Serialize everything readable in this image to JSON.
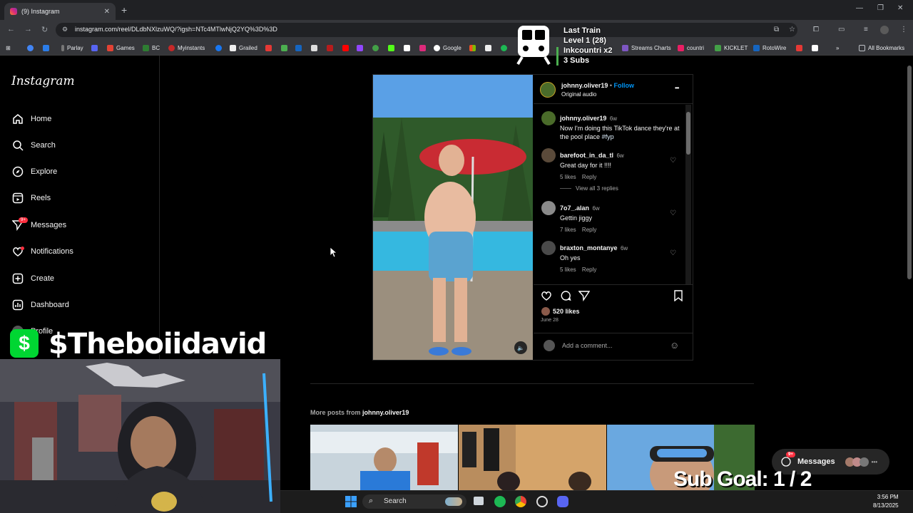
{
  "browser": {
    "tab_title": "(9) Instagram",
    "new_tab": "+",
    "url": "instagram.com/reel/DLdbNXlzuWQ/?igsh=NTc4MTlwNjQ2YQ%3D%3D",
    "bookmarks": [
      "Parlay",
      "Games",
      "BC",
      "Myinstants",
      "Grailed",
      "Google",
      "Streams Charts",
      "countri",
      "KICKLET",
      "RotoWire"
    ],
    "all_bookmarks": "All Bookmarks",
    "win_min": "—",
    "win_max": "❐",
    "win_close": "✕"
  },
  "overlay": {
    "train_title": "Last Train",
    "train_level": "Level 1 (28)",
    "train_user": "Inkcountri x2",
    "train_subs": "3 Subs",
    "cash_symbol": "$",
    "cashtag": "$Theboiidavid",
    "sub_goal": "Sub Goal:  1 / 2"
  },
  "sidebar": {
    "logo": "Instagram",
    "items": [
      {
        "label": "Home",
        "icon": "home-icon"
      },
      {
        "label": "Search",
        "icon": "search-icon"
      },
      {
        "label": "Explore",
        "icon": "compass-icon"
      },
      {
        "label": "Reels",
        "icon": "reels-icon"
      },
      {
        "label": "Messages",
        "icon": "send-icon"
      },
      {
        "label": "Notifications",
        "icon": "heart-icon"
      },
      {
        "label": "Create",
        "icon": "plus-icon"
      },
      {
        "label": "Dashboard",
        "icon": "dashboard-icon"
      },
      {
        "label": "Profile",
        "icon": "avatar-icon"
      }
    ],
    "messages_badge": "9+"
  },
  "post": {
    "author": "johnny.oliver19",
    "follow": "Follow",
    "audio": "Original audio",
    "more": "•••",
    "comments": [
      {
        "user": "johnny.oliver19",
        "time": "6w",
        "text": "Now I'm doing this TikTok dance they're at the pool place",
        "tag": "#fyp"
      },
      {
        "user": "barefoot_in_da_tl",
        "time": "6w",
        "text": "Great day for it !!!!",
        "likes": "5 likes",
        "reply": "Reply"
      },
      {
        "user": "7o7_.alan",
        "time": "6w",
        "text": "Gettin jiggy",
        "likes": "7 likes",
        "reply": "Reply"
      },
      {
        "user": "braxton_montanye",
        "time": "6w",
        "text": "Oh yes",
        "likes": "5 likes",
        "reply": "Reply"
      }
    ],
    "view_replies": "View all 3 replies",
    "likes": "520 likes",
    "date": "June 28",
    "add_comment": "Add a comment..."
  },
  "more_posts": {
    "prefix": "More posts from",
    "user": "johnny.oliver19"
  },
  "messages_float": {
    "label": "Messages",
    "badge": "9+"
  },
  "taskbar": {
    "search": "Search",
    "time": "3:56 PM",
    "date": "8/13/2025"
  }
}
